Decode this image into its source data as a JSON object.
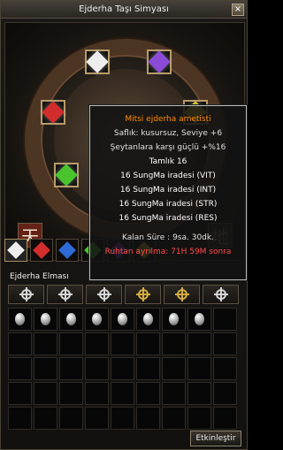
{
  "window": {
    "title": "Ejderha Taşı Simyası",
    "close_icon": "×"
  },
  "gems": [
    {
      "name": "white-gem",
      "color": "#ededed"
    },
    {
      "name": "purple-gem",
      "color": "#8b4bd7"
    },
    {
      "name": "red-gem",
      "color": "#d22c2c"
    },
    {
      "name": "yellow-gem",
      "color": "#d9c12a"
    },
    {
      "name": "green-gem",
      "color": "#4ac42e"
    }
  ],
  "badges": {
    "left": "天",
    "right": "地"
  },
  "tooltip": {
    "title": "Mitsi ejderha ametisti",
    "quality": "Saflık: kusursuz, Seviye +6",
    "bonus": "Şeytanlara karşı güçlü +%16",
    "perfection": "Tamlık 16",
    "stats": [
      "16 SungMa iradesi (VIT)",
      "16 SungMa iradesi (INT)",
      "16 SungMa iradesi (STR)",
      "16 SungMa iradesi (RES)"
    ],
    "remaining": "Kalan Süre : 9sa. 30dk.",
    "expire": "Ruhtan ayrılma: 71H 59M sonra"
  },
  "section": {
    "label": "Ejderha Elması"
  },
  "tab_colors": [
    "#ededed",
    "#d22c2c",
    "#2d6ad6",
    "#4ac42e",
    "#8b4bd7",
    "#d9c12a"
  ],
  "type_slots": [
    {
      "icon": "sunburst-icon",
      "color": "#d7d7d7"
    },
    {
      "icon": "sunburst-icon",
      "color": "#d7d7d7"
    },
    {
      "icon": "sunburst-icon",
      "color": "#d7d7d7"
    },
    {
      "icon": "sunburst-icon",
      "color": "#d6ad40"
    },
    {
      "icon": "sunburst-icon",
      "color": "#d6ad40"
    },
    {
      "icon": "sunburst-icon",
      "color": "#d7d7d7"
    }
  ],
  "grid": {
    "rows": 5,
    "cols": 9,
    "filled_count": 8
  },
  "buttons": {
    "activate": "Etkinleştir"
  }
}
